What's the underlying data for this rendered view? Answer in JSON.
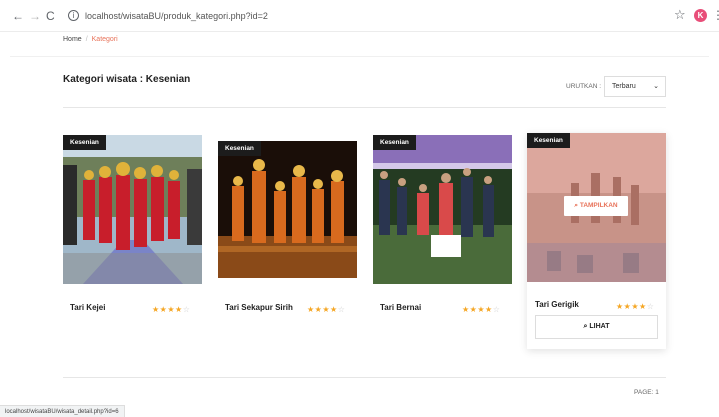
{
  "browser": {
    "url": "localhost/wisataBU/produk_kategori.php?id=2",
    "profile_initial": "K"
  },
  "breadcrumb": {
    "home": "Home",
    "current": "Kategori"
  },
  "header": {
    "title": "Kategori wisata : Kesenian",
    "sort_label": "URUTKAN :",
    "sort_value": "Terbaru"
  },
  "products": [
    {
      "badge": "Kesenian",
      "title": "Tari Kejei",
      "rating": 4
    },
    {
      "badge": "Kesenian",
      "title": "Tari Sekapur Sirih",
      "rating": 4
    },
    {
      "badge": "Kesenian",
      "title": "Tari Bernai",
      "rating": 4
    },
    {
      "badge": "Kesenian",
      "title": "Tari Gerigik",
      "rating": 4,
      "hover_label": "TAMPILKAN",
      "button_label": "LIHAT"
    }
  ],
  "stars": {
    "filled": "★★★★",
    "empty": "☆"
  },
  "pagination": {
    "label": "PAGE: 1"
  },
  "status_bar": {
    "text": "localhost/wisataBU/wisata_detail.php?id=6"
  },
  "colors": {
    "accent": "#e8735a",
    "star": "#f5a623",
    "badge": "#1c1c1c"
  }
}
